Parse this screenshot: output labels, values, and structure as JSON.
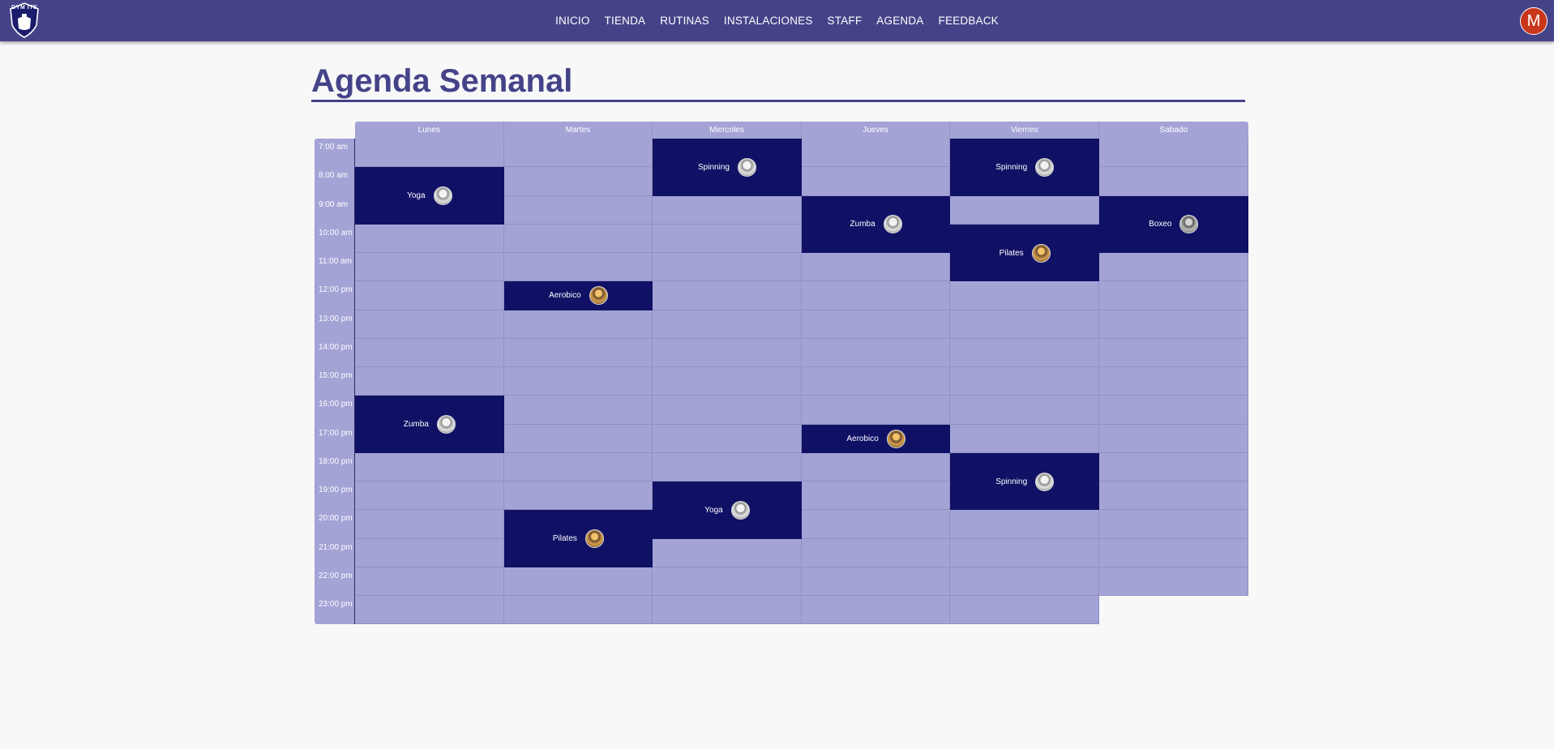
{
  "nav": {
    "logo_text": "GYM ITS",
    "links": [
      "INICIO",
      "TIENDA",
      "RUTINAS",
      "INSTALACIONES",
      "STAFF",
      "AGENDA",
      "FEEDBACK"
    ],
    "avatar_initial": "M"
  },
  "page": {
    "title": "Agenda Semanal"
  },
  "schedule": {
    "days": [
      "Lunes",
      "Martes",
      "Miercoles",
      "Jueves",
      "Viernes",
      "Sabado"
    ],
    "times": [
      "7:00 am",
      "8:00 am",
      "9:00 am",
      "10:00 am",
      "11:00 am",
      "12:00 pm",
      "13:00 pm",
      "14:00 pm",
      "15:00 pm",
      "16:00 pm",
      "17:00 pm",
      "18:00 pm",
      "19:00 pm",
      "20:00 pm",
      "21:00 pm",
      "22:00 pm",
      "23:00 pm"
    ],
    "day_last_slot": [
      16,
      16,
      16,
      16,
      16,
      15
    ],
    "events": [
      {
        "name": "Yoga",
        "day": "Lunes",
        "start": "8:00 am",
        "hours": 2,
        "trainer": "light"
      },
      {
        "name": "Zumba",
        "day": "Lunes",
        "start": "16:00 pm",
        "hours": 2,
        "trainer": "light"
      },
      {
        "name": "Aerobico",
        "day": "Martes",
        "start": "12:00 pm",
        "hours": 1,
        "trainer": "dark"
      },
      {
        "name": "Pilates",
        "day": "Martes",
        "start": "20:00 pm",
        "hours": 2,
        "trainer": "dark"
      },
      {
        "name": "Spinning",
        "day": "Miercoles",
        "start": "7:00 am",
        "hours": 2,
        "trainer": "light"
      },
      {
        "name": "Yoga",
        "day": "Miercoles",
        "start": "19:00 pm",
        "hours": 2,
        "trainer": "light"
      },
      {
        "name": "Zumba",
        "day": "Jueves",
        "start": "9:00 am",
        "hours": 2,
        "trainer": "light"
      },
      {
        "name": "Aerobico",
        "day": "Jueves",
        "start": "17:00 pm",
        "hours": 1,
        "trainer": "dark"
      },
      {
        "name": "Spinning",
        "day": "Viernes",
        "start": "7:00 am",
        "hours": 2,
        "trainer": "light"
      },
      {
        "name": "Pilates",
        "day": "Viernes",
        "start": "10:00 am",
        "hours": 2,
        "trainer": "dark"
      },
      {
        "name": "Spinning",
        "day": "Viernes",
        "start": "18:00 pm",
        "hours": 2,
        "trainer": "light"
      },
      {
        "name": "Boxeo",
        "day": "Sabado",
        "start": "9:00 am",
        "hours": 2,
        "trainer": "gray"
      }
    ]
  }
}
